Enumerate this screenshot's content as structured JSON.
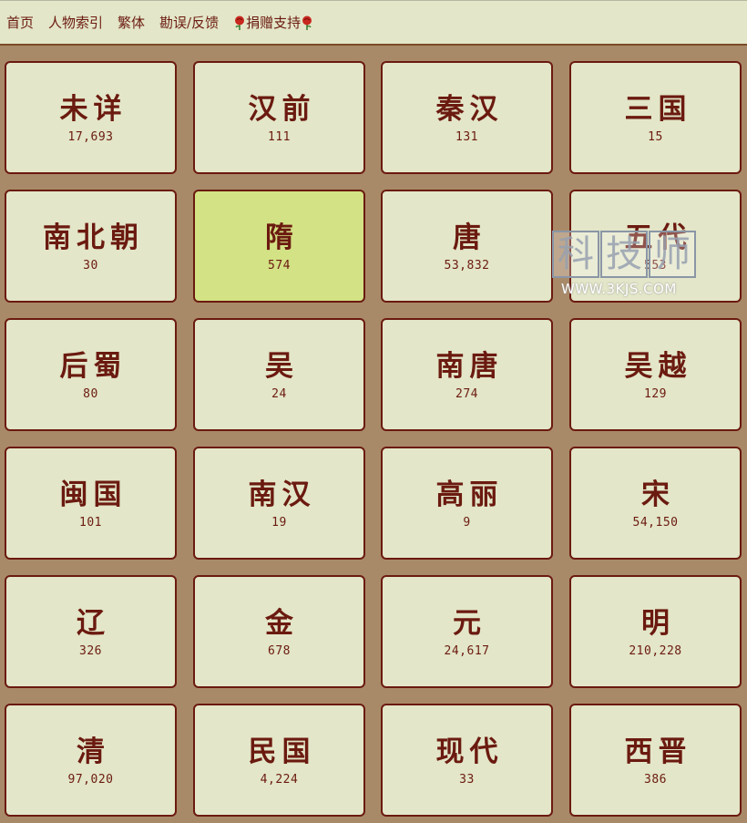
{
  "nav": {
    "home": "首页",
    "person_index": "人物索引",
    "traditional": "繁体",
    "feedback": "勘误/反馈",
    "donate": "捐赠支持",
    "donate_icon": "rose-icon",
    "rose_color": "#c8281e"
  },
  "dynasties": [
    {
      "name": "未详",
      "count": "17,693"
    },
    {
      "name": "汉前",
      "count": "111"
    },
    {
      "name": "秦汉",
      "count": "131"
    },
    {
      "name": "三国",
      "count": "15"
    },
    {
      "name": "南北朝",
      "count": "30"
    },
    {
      "name": "隋",
      "count": "574",
      "selected": true
    },
    {
      "name": "唐",
      "count": "53,832"
    },
    {
      "name": "五代",
      "count": "553"
    },
    {
      "name": "后蜀",
      "count": "80"
    },
    {
      "name": "吴",
      "count": "24"
    },
    {
      "name": "南唐",
      "count": "274"
    },
    {
      "name": "吴越",
      "count": "129"
    },
    {
      "name": "闽国",
      "count": "101"
    },
    {
      "name": "南汉",
      "count": "19"
    },
    {
      "name": "高丽",
      "count": "9"
    },
    {
      "name": "宋",
      "count": "54,150"
    },
    {
      "name": "辽",
      "count": "326"
    },
    {
      "name": "金",
      "count": "678"
    },
    {
      "name": "元",
      "count": "24,617"
    },
    {
      "name": "明",
      "count": "210,228"
    },
    {
      "name": "清",
      "count": "97,020"
    },
    {
      "name": "民国",
      "count": "4,224"
    },
    {
      "name": "现代",
      "count": "33"
    },
    {
      "name": "西晋",
      "count": "386"
    }
  ],
  "watermark": {
    "chars": [
      "科",
      "技",
      "师"
    ],
    "url": "WWW.3KJS.COM"
  },
  "colors": {
    "page_bg": "#a98a68",
    "tile_bg": "#e3e6c8",
    "tile_selected_bg": "#d3e285",
    "text": "#6b1a10"
  }
}
